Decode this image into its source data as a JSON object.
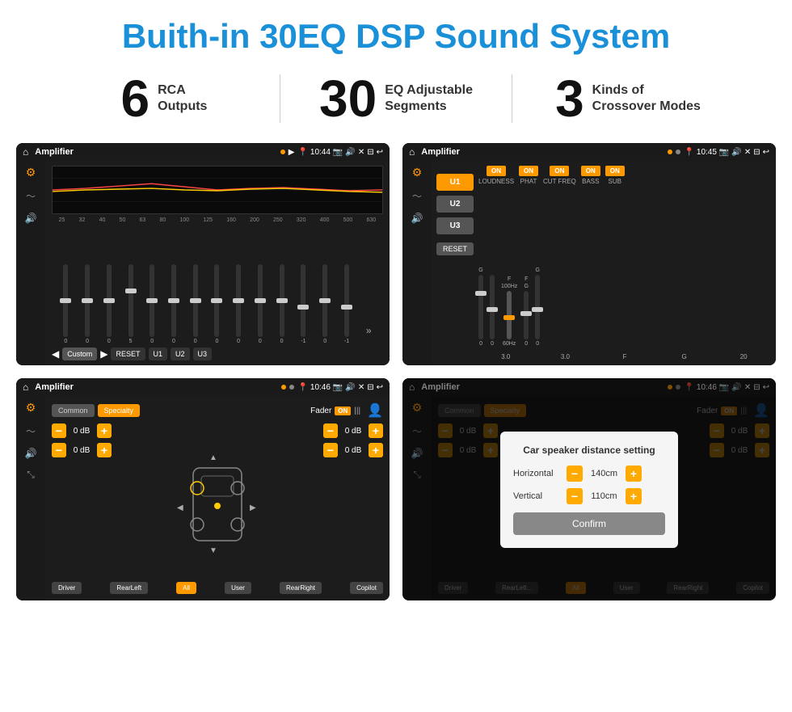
{
  "title": "Buith-in 30EQ DSP Sound System",
  "stats": [
    {
      "number": "6",
      "text": "RCA\nOutputs"
    },
    {
      "number": "30",
      "text": "EQ Adjustable\nSegments"
    },
    {
      "number": "3",
      "text": "Kinds of\nCrossover Modes"
    }
  ],
  "screens": [
    {
      "id": "eq-screen",
      "app": "Amplifier",
      "time": "10:44",
      "freq_labels": [
        "25",
        "32",
        "40",
        "50",
        "63",
        "80",
        "100",
        "125",
        "160",
        "200",
        "250",
        "320",
        "400",
        "500",
        "630"
      ],
      "slider_values": [
        "0",
        "0",
        "0",
        "5",
        "0",
        "0",
        "0",
        "0",
        "0",
        "0",
        "0",
        "-1",
        "0",
        "-1"
      ],
      "eq_modes": [
        "Custom",
        "RESET",
        "U1",
        "U2",
        "U3"
      ]
    },
    {
      "id": "amp-screen",
      "app": "Amplifier",
      "time": "10:45",
      "channels": [
        "U1",
        "U2",
        "U3"
      ],
      "toggles": [
        "LOUDNESS",
        "PHAT",
        "CUT FREQ",
        "BASS",
        "SUB"
      ],
      "reset": "RESET"
    },
    {
      "id": "fader-screen",
      "app": "Amplifier",
      "time": "10:46",
      "tabs": [
        "Common",
        "Specialty"
      ],
      "fader_label": "Fader",
      "fader_on": "ON",
      "db_values": [
        "0 dB",
        "0 dB",
        "0 dB",
        "0 dB"
      ],
      "positions": [
        "Driver",
        "RearLeft",
        "All",
        "User",
        "RearRight",
        "Copilot"
      ]
    },
    {
      "id": "dialog-screen",
      "app": "Amplifier",
      "time": "10:46",
      "tabs": [
        "Common",
        "Specialty"
      ],
      "dialog": {
        "title": "Car speaker distance setting",
        "horizontal_label": "Horizontal",
        "horizontal_value": "140cm",
        "vertical_label": "Vertical",
        "vertical_value": "110cm",
        "confirm": "Confirm"
      },
      "db_values": [
        "0 dB",
        "0 dB"
      ]
    }
  ]
}
